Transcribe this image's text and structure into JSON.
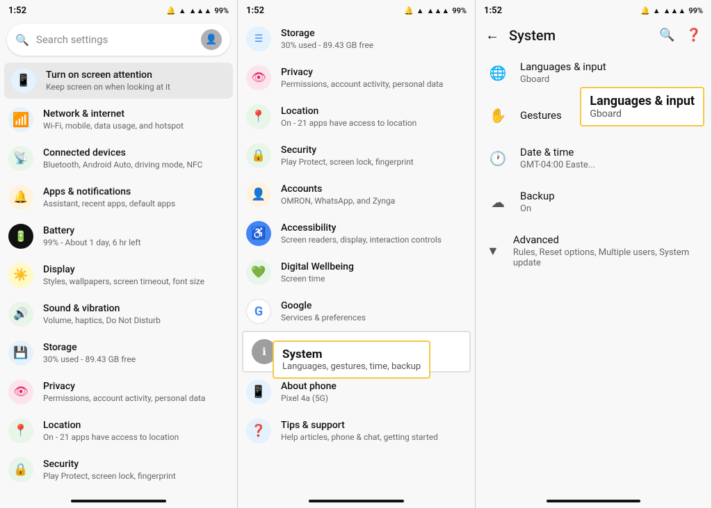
{
  "colors": {
    "blue": "#4285f4",
    "green": "#34a853",
    "orange": "#ff6d00",
    "red": "#ea4335",
    "purple": "#9c27b0",
    "teal": "#009688",
    "cyan": "#00bcd4",
    "indigo": "#3f51b5",
    "grey": "#9e9e9e",
    "yellow_highlight": "#f5c842"
  },
  "panel1": {
    "status": {
      "time": "1:52",
      "battery": "99%"
    },
    "search": {
      "placeholder": "Search settings"
    },
    "items": [
      {
        "icon": "📱",
        "icon_bg": "#e3f2fd",
        "title": "Turn on screen attention",
        "subtitle": "Keep screen on when looking at it",
        "highlighted": true
      },
      {
        "icon": "📶",
        "icon_bg": "#e3f2fd",
        "title": "Network & internet",
        "subtitle": "Wi-Fi, mobile, data usage, and hotspot"
      },
      {
        "icon": "📡",
        "icon_bg": "#e8f5e9",
        "title": "Connected devices",
        "subtitle": "Bluetooth, Android Auto, driving mode, NFC"
      },
      {
        "icon": "🔔",
        "icon_bg": "#fff3e0",
        "title": "Apps & notifications",
        "subtitle": "Assistant, recent apps, default apps"
      },
      {
        "icon": "🔋",
        "icon_bg": "#212121",
        "title": "Battery",
        "subtitle": "99% - About 1 day, 6 hr left"
      },
      {
        "icon": "☀️",
        "icon_bg": "#fff9c4",
        "title": "Display",
        "subtitle": "Styles, wallpapers, screen timeout, font size"
      },
      {
        "icon": "🔊",
        "icon_bg": "#e8f5e9",
        "title": "Sound & vibration",
        "subtitle": "Volume, haptics, Do Not Disturb"
      },
      {
        "icon": "💾",
        "icon_bg": "#e3f2fd",
        "title": "Storage",
        "subtitle": "30% used - 89.43 GB free"
      },
      {
        "icon": "👁",
        "icon_bg": "#fce4ec",
        "title": "Privacy",
        "subtitle": "Permissions, account activity, personal data"
      },
      {
        "icon": "📍",
        "icon_bg": "#e8f5e9",
        "title": "Location",
        "subtitle": "On - 21 apps have access to location"
      },
      {
        "icon": "🔒",
        "icon_bg": "#e8f5e9",
        "title": "Security",
        "subtitle": "Play Protect, screen lock, fingerprint"
      }
    ]
  },
  "panel2": {
    "status": {
      "time": "1:52",
      "battery": "99%"
    },
    "items": [
      {
        "icon": "☰",
        "icon_bg": "#e3f2fd",
        "title": "Storage",
        "subtitle": "30% used - 89.43 GB free"
      },
      {
        "icon": "👁",
        "icon_bg": "#fce4ec",
        "title": "Privacy",
        "subtitle": "Permissions, account activity, personal data"
      },
      {
        "icon": "📍",
        "icon_bg": "#e8f5e9",
        "title": "Location",
        "subtitle": "On - 21 apps have access to location"
      },
      {
        "icon": "🔒",
        "icon_bg": "#e8f5e9",
        "title": "Security",
        "subtitle": "Play Protect, screen lock, fingerprint"
      },
      {
        "icon": "👤",
        "icon_bg": "#fff3e0",
        "title": "Accounts",
        "subtitle": "OMRON, WhatsApp, and Zynga"
      },
      {
        "icon": "♿",
        "icon_bg": "#4285f4",
        "title": "Accessibility",
        "subtitle": "Screen readers, display, interaction controls"
      },
      {
        "icon": "💚",
        "icon_bg": "#e8f5e9",
        "title": "Digital Wellbeing",
        "subtitle": "Screen time"
      },
      {
        "icon": "G",
        "icon_bg": "#fff",
        "title": "Google",
        "subtitle": "Services & preferences"
      },
      {
        "icon": "ℹ",
        "icon_bg": "#9e9e9e",
        "title": "System",
        "subtitle": "Languages, gestures, time, backup"
      },
      {
        "icon": "📱",
        "icon_bg": "#e3f2fd",
        "title": "About phone",
        "subtitle": "Pixel 4a (5G)"
      },
      {
        "icon": "❓",
        "icon_bg": "#e3f2fd",
        "title": "Tips & support",
        "subtitle": "Help articles, phone & chat, getting started"
      }
    ],
    "tooltip": {
      "title": "System",
      "subtitle": "Languages, gestures, time, backup"
    }
  },
  "panel3": {
    "status": {
      "time": "1:52",
      "battery": "99%"
    },
    "header": {
      "title": "System"
    },
    "items": [
      {
        "icon": "🌐",
        "title": "Languages & input",
        "subtitle": "Gboard"
      },
      {
        "icon": "✋",
        "title": "Gestures",
        "subtitle": ""
      },
      {
        "icon": "🕐",
        "title": "Date & time",
        "subtitle": "GMT-04:00 Easte..."
      },
      {
        "icon": "☁",
        "title": "Backup",
        "subtitle": "On"
      },
      {
        "icon": "▼",
        "title": "Advanced",
        "subtitle": "Rules, Reset options, Multiple users, System update",
        "is_advanced": true
      }
    ],
    "callout": {
      "title": "Languages & input",
      "subtitle": "Gboard"
    }
  }
}
